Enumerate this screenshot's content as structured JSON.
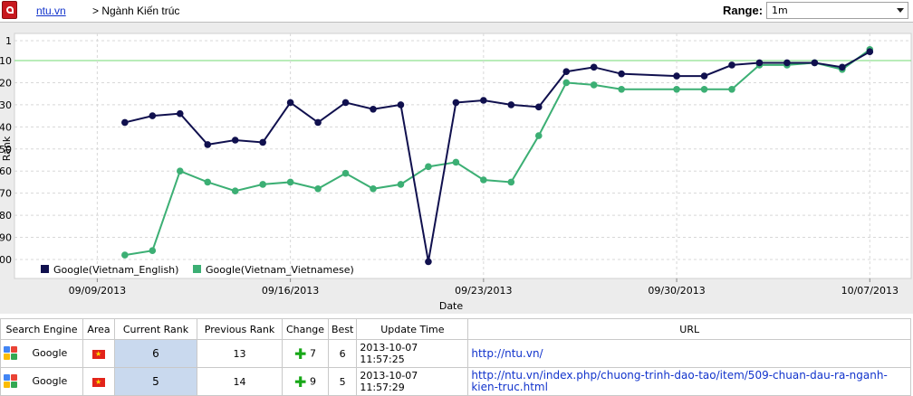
{
  "toolbar": {
    "pdf_icon": "pdf-icon",
    "site_link": "ntu.vn",
    "breadcrumb": "> Ngành Kiến trúc",
    "range_label": "Range:",
    "range_value": "1m"
  },
  "chart_data": {
    "type": "line",
    "xlabel": "Date",
    "ylabel": "Rank",
    "y_inverted": true,
    "ylim": [
      1,
      100
    ],
    "y_ticks": [
      "1",
      "10",
      "20",
      "30",
      "40",
      "50",
      "60",
      "70",
      "80",
      "90",
      "100"
    ],
    "x_ticks": [
      "09/09/2013",
      "09/16/2013",
      "09/23/2013",
      "09/30/2013",
      "10/07/2013"
    ],
    "target_line": 10,
    "legend_position": "bottom-left",
    "grid": true,
    "x": [
      "09/10/2013",
      "09/11/2013",
      "09/12/2013",
      "09/13/2013",
      "09/14/2013",
      "09/15/2013",
      "09/16/2013",
      "09/17/2013",
      "09/18/2013",
      "09/19/2013",
      "09/20/2013",
      "09/21/2013",
      "09/22/2013",
      "09/23/2013",
      "09/24/2013",
      "09/25/2013",
      "09/26/2013",
      "09/27/2013",
      "09/28/2013",
      "09/30/2013",
      "10/01/2013",
      "10/02/2013",
      "10/03/2013",
      "10/04/2013",
      "10/05/2013",
      "10/06/2013",
      "10/07/2013"
    ],
    "series": [
      {
        "name": "Google(Vietnam_English)",
        "color": "#10104e",
        "values": [
          38,
          35,
          34,
          48,
          46,
          47,
          29,
          38,
          29,
          32,
          30,
          101,
          29,
          28,
          30,
          31,
          15,
          13,
          16,
          17,
          17,
          12,
          11,
          11,
          11,
          13,
          6
        ]
      },
      {
        "name": "Google(Vietnam_Vietnamese)",
        "color": "#3caf74",
        "values": [
          98,
          96,
          60,
          65,
          69,
          66,
          65,
          68,
          61,
          68,
          66,
          58,
          56,
          64,
          65,
          44,
          20,
          21,
          23,
          23,
          23,
          23,
          12,
          12,
          11,
          14,
          5
        ]
      }
    ]
  },
  "table": {
    "headers": [
      "Search Engine",
      "Area",
      "Current Rank",
      "Previous Rank",
      "Change",
      "Best",
      "Update Time",
      "URL"
    ],
    "rows": [
      {
        "engine": "Google",
        "current": "6",
        "previous": "13",
        "change": "7",
        "best": "6",
        "updated": "2013-10-07 11:57:25",
        "url": "http://ntu.vn/"
      },
      {
        "engine": "Google",
        "current": "5",
        "previous": "14",
        "change": "9",
        "best": "5",
        "updated": "2013-10-07 11:57:29",
        "url": "http://ntu.vn/index.php/chuong-trinh-dao-tao/item/509-chuan-dau-ra-nganh-kien-truc.html"
      }
    ]
  }
}
